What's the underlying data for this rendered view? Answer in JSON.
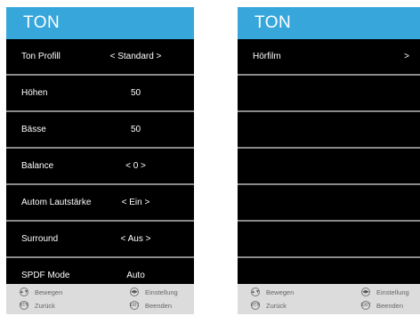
{
  "left": {
    "title": "TON",
    "rows": [
      {
        "label": "Ton Profill",
        "value": "<  Standard  >"
      },
      {
        "label": "Höhen",
        "value": "50"
      },
      {
        "label": "Bässe",
        "value": "50"
      },
      {
        "label": "Balance",
        "value": "<   0   >"
      },
      {
        "label": "Autom Lautstärke",
        "value": "<   Ein   >"
      },
      {
        "label": "Surround",
        "value": "<  Aus  >"
      },
      {
        "label": "SPDF Mode",
        "value": "Auto"
      }
    ],
    "footer": {
      "move": "Bewegen",
      "setting": "Einstellung",
      "back": "Zurück",
      "exit": "Beenden",
      "move_icon": "arrows-updown-icon",
      "setting_icon": "arrows-leftright-icon",
      "back_icon": "return-icon",
      "exit_icon": "exit-icon"
    }
  },
  "right": {
    "title": "TON",
    "rows": [
      {
        "label": "Hörfilm",
        "value": ">"
      }
    ],
    "footer": {
      "move": "Bewegen",
      "setting": "Einstellung",
      "back": "Zurück",
      "exit": "Beenden"
    }
  },
  "colors": {
    "header": "#37a7db",
    "panel": "#000000",
    "divider": "#8a8a8a",
    "footer": "#dcdcdc"
  }
}
